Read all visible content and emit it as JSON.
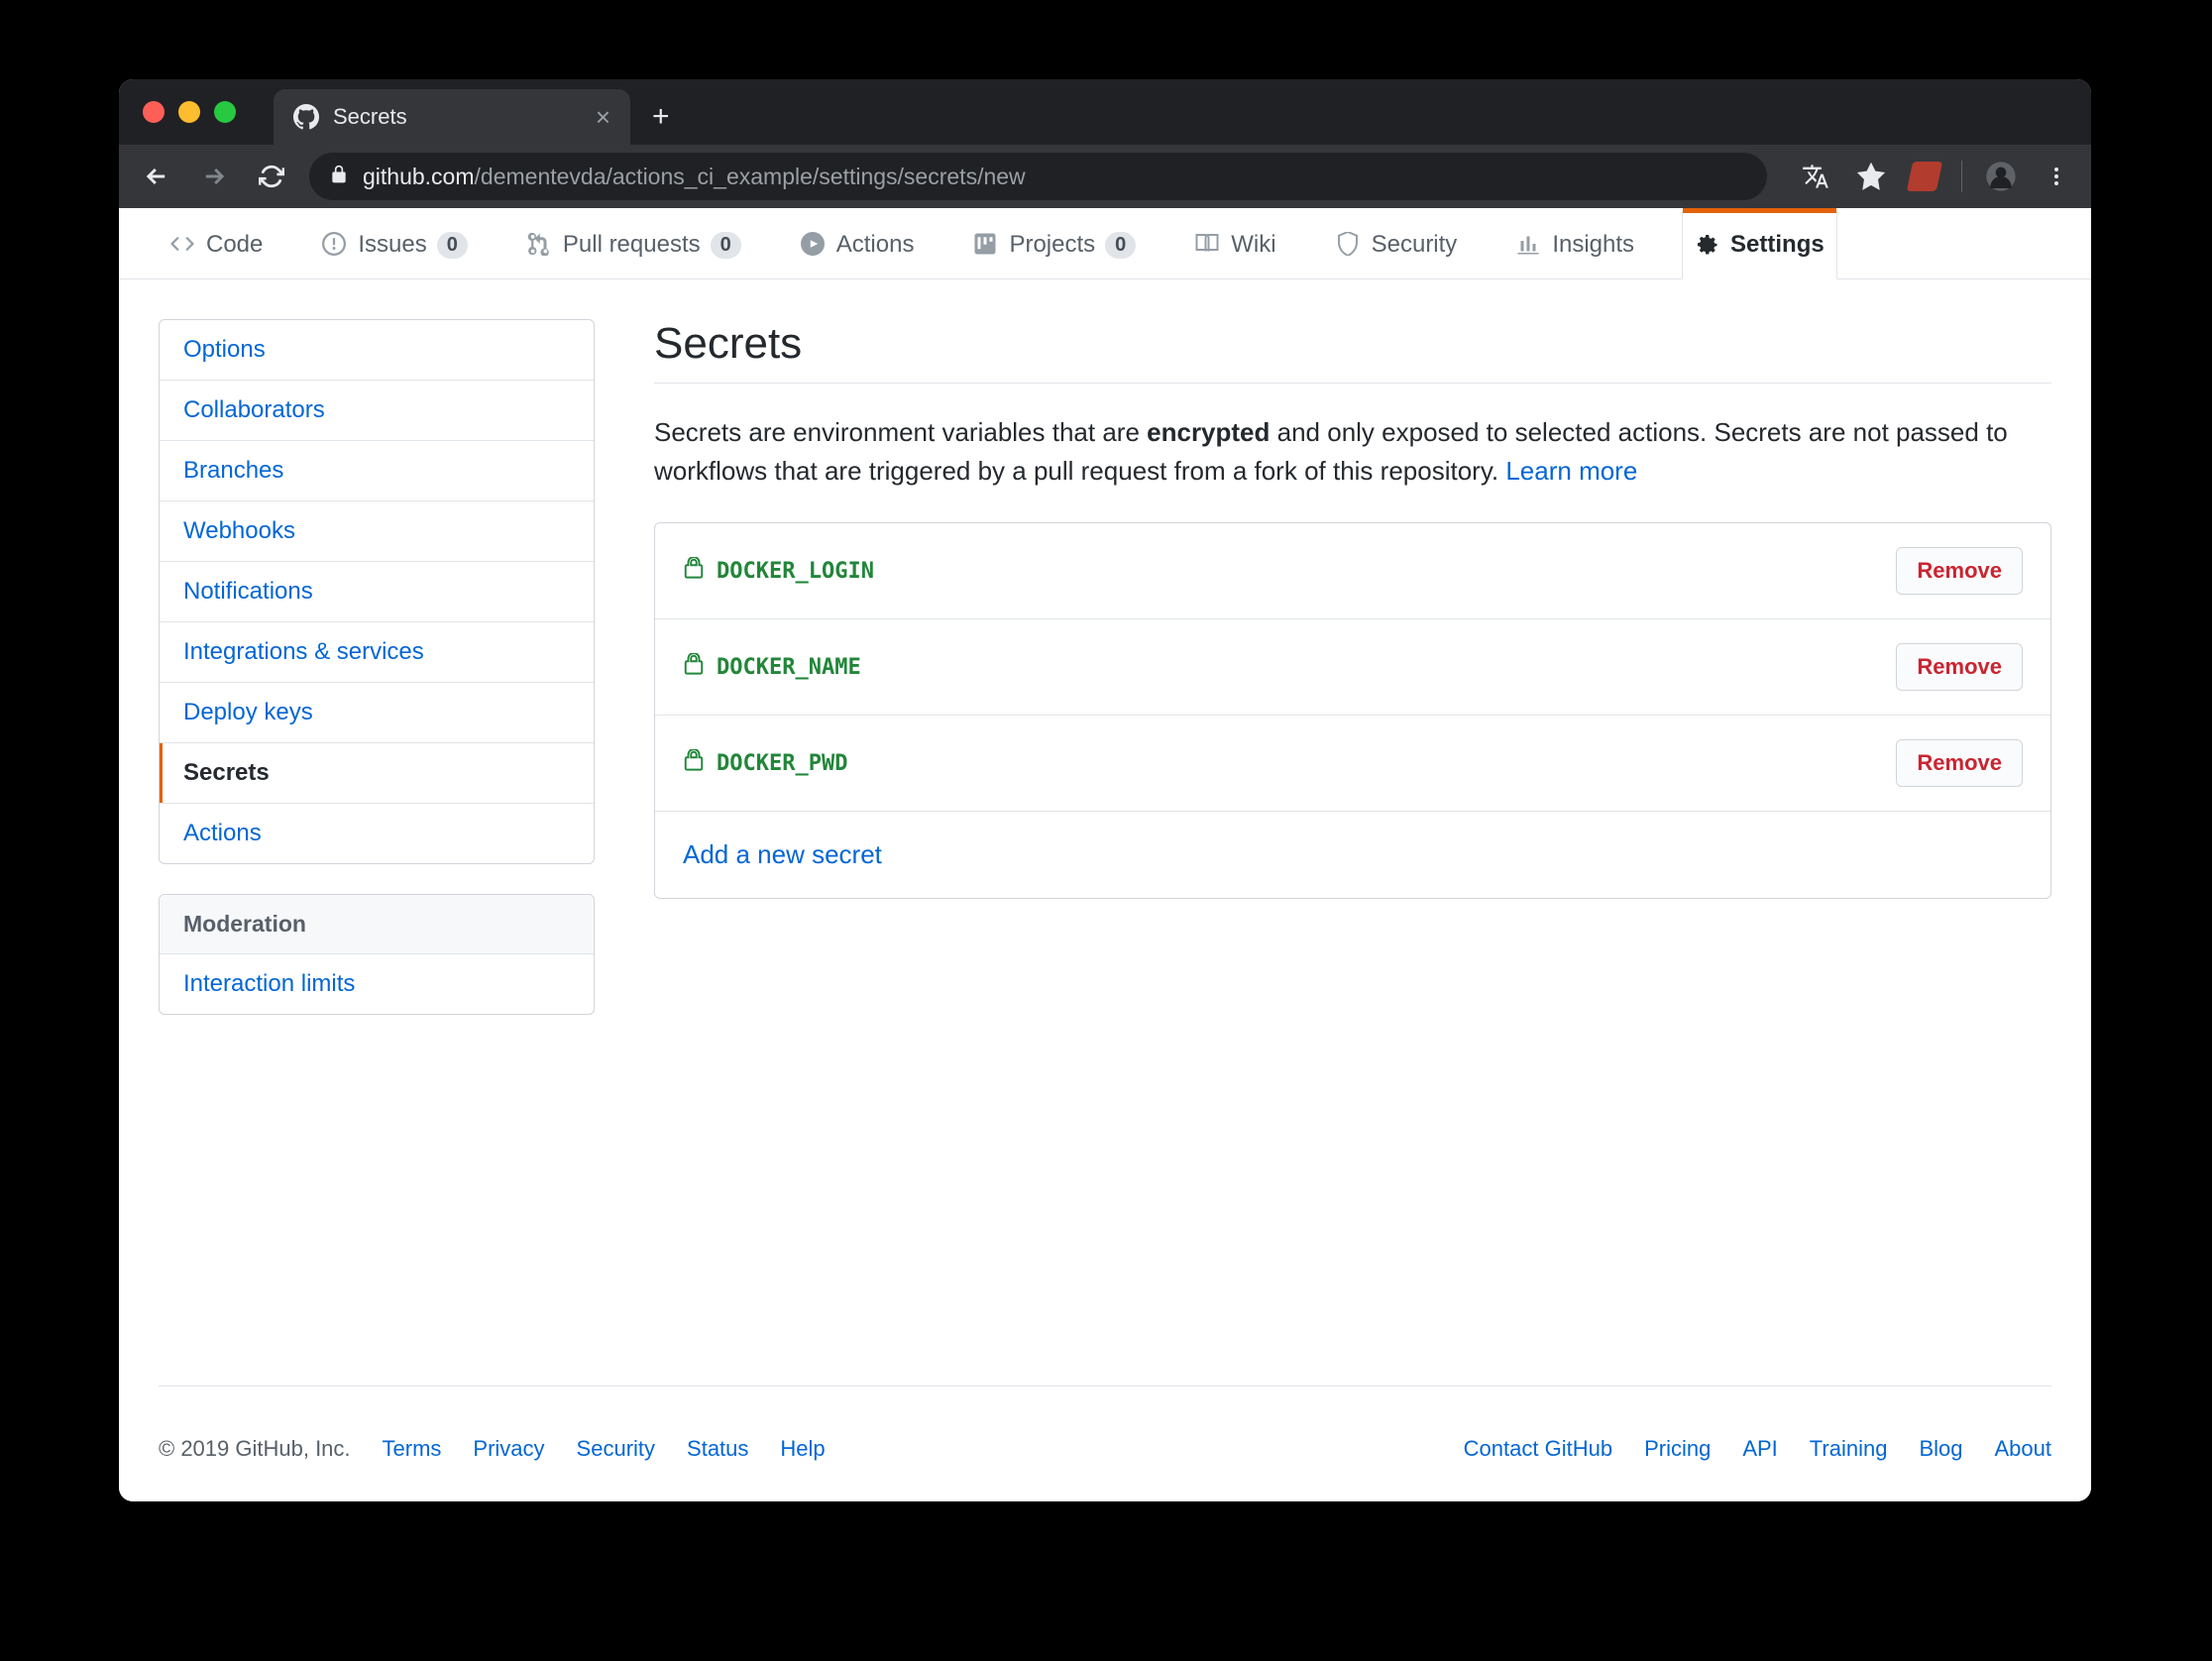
{
  "browser": {
    "tab_title": "Secrets",
    "url_host": "github.com",
    "url_path": "/dementevda/actions_ci_example/settings/secrets/new"
  },
  "repo_nav": {
    "code": "Code",
    "issues": "Issues",
    "issues_count": "0",
    "pulls": "Pull requests",
    "pulls_count": "0",
    "actions": "Actions",
    "projects": "Projects",
    "projects_count": "0",
    "wiki": "Wiki",
    "security": "Security",
    "insights": "Insights",
    "settings": "Settings"
  },
  "sidebar": {
    "items": [
      {
        "label": "Options"
      },
      {
        "label": "Collaborators"
      },
      {
        "label": "Branches"
      },
      {
        "label": "Webhooks"
      },
      {
        "label": "Notifications"
      },
      {
        "label": "Integrations & services"
      },
      {
        "label": "Deploy keys"
      },
      {
        "label": "Secrets"
      },
      {
        "label": "Actions"
      }
    ],
    "moderation_header": "Moderation",
    "moderation_items": [
      {
        "label": "Interaction limits"
      }
    ]
  },
  "main": {
    "title": "Secrets",
    "desc_pre": "Secrets are environment variables that are ",
    "desc_bold": "encrypted",
    "desc_post": " and only exposed to selected actions. Secrets are not passed to workflows that are triggered by a pull request from a fork of this repository. ",
    "learn_more": "Learn more",
    "secrets": [
      {
        "name": "DOCKER_LOGIN",
        "remove": "Remove"
      },
      {
        "name": "DOCKER_NAME",
        "remove": "Remove"
      },
      {
        "name": "DOCKER_PWD",
        "remove": "Remove"
      }
    ],
    "add_link": "Add a new secret"
  },
  "footer": {
    "copyright": "© 2019 GitHub, Inc.",
    "left": [
      "Terms",
      "Privacy",
      "Security",
      "Status",
      "Help"
    ],
    "right": [
      "Contact GitHub",
      "Pricing",
      "API",
      "Training",
      "Blog",
      "About"
    ]
  }
}
